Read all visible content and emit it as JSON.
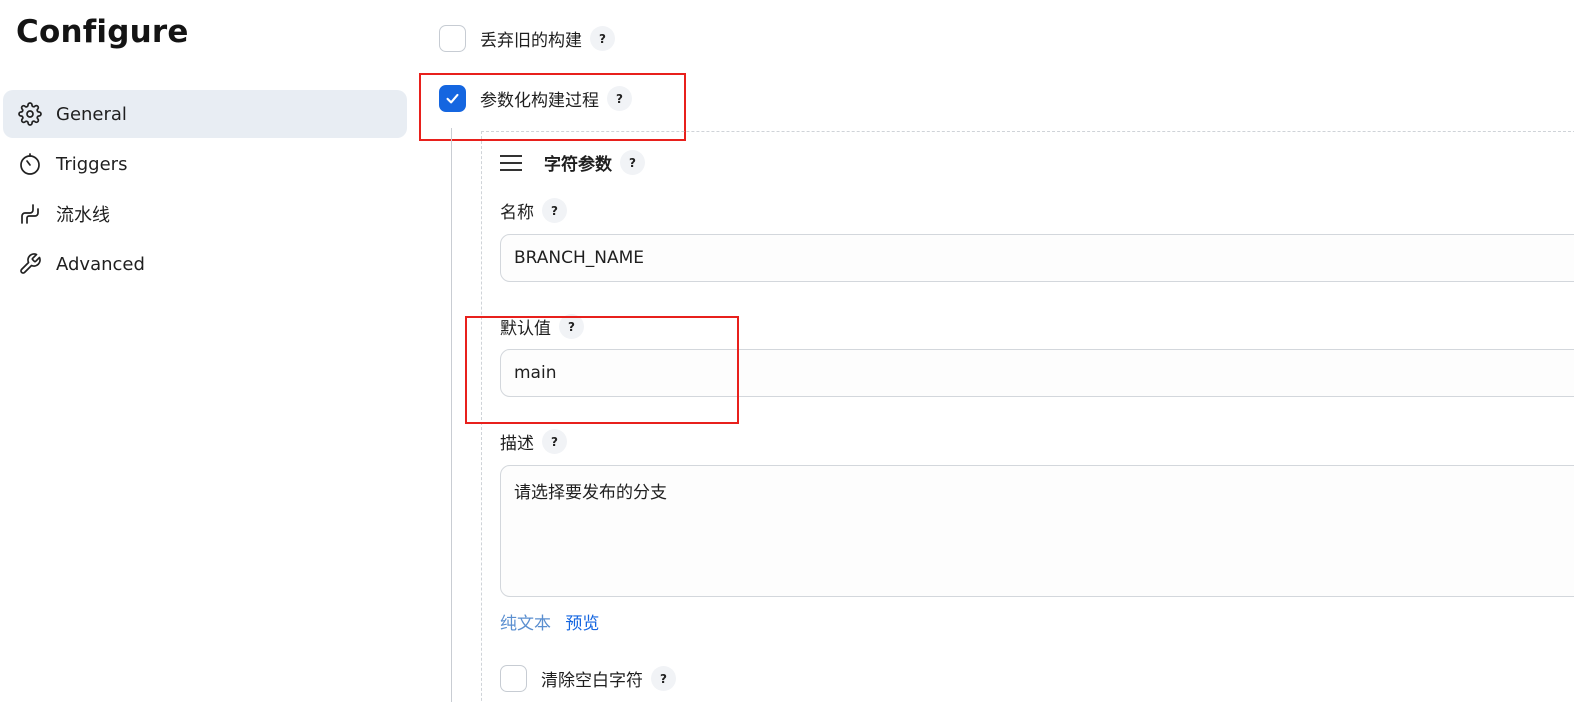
{
  "page": {
    "title": "Configure"
  },
  "sidebar": {
    "items": [
      {
        "label": "General",
        "icon": "gear-icon",
        "active": true
      },
      {
        "label": "Triggers",
        "icon": "timer-icon",
        "active": false
      },
      {
        "label": "流水线",
        "icon": "pipeline-icon",
        "active": false
      },
      {
        "label": "Advanced",
        "icon": "wrench-icon",
        "active": false
      }
    ]
  },
  "options": {
    "discard_old_builds": {
      "label": "丢弃旧的构建",
      "checked": false
    },
    "parameterized": {
      "label": "参数化构建过程",
      "checked": true
    }
  },
  "help_glyph": "?",
  "parameter": {
    "type_label": "字符参数",
    "name": {
      "label": "名称",
      "value": "BRANCH_NAME"
    },
    "default": {
      "label": "默认值",
      "value": "main"
    },
    "description": {
      "label": "描述",
      "value": "请选择要发布的分支"
    },
    "links": {
      "plain_text": "纯文本",
      "preview": "预览"
    },
    "trim": {
      "label": "清除空白字符",
      "checked": false
    }
  },
  "colors": {
    "accent": "#1566e0",
    "active_nav_bg": "#e8edf3",
    "highlight_box": "#e8201c"
  }
}
